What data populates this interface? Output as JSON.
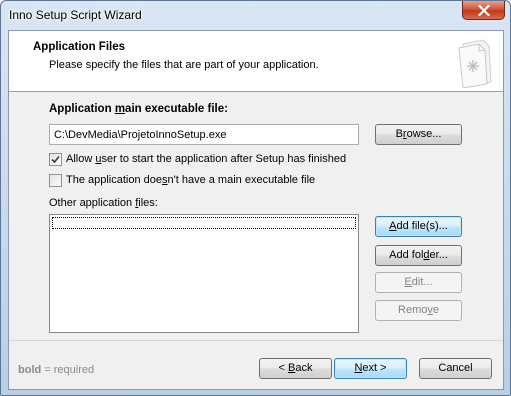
{
  "window": {
    "title": "Inno Setup Script Wizard"
  },
  "header": {
    "title": "Application Files",
    "subtitle": "Please specify the files that are part of your application.",
    "icon": "document-icon"
  },
  "main_executable": {
    "label_pre": "Application ",
    "label_access": "m",
    "label_post": "ain executable file:",
    "value": "C:\\DevMedia\\ProjetoInnoSetup.exe",
    "browse_pre": "B",
    "browse_access": "r",
    "browse_post": "owse..."
  },
  "options": {
    "allow_start_pre": "Allow ",
    "allow_start_access": "u",
    "allow_start_post": "ser to start the application after Setup has finished",
    "allow_start_checked": true,
    "no_main_exe_pre": "The application doe",
    "no_main_exe_access": "s",
    "no_main_exe_post": "n't have a main executable file",
    "no_main_exe_checked": false
  },
  "other_files": {
    "label_pre": "Other application ",
    "label_access": "f",
    "label_post": "iles:",
    "items": [],
    "add_files_pre": "",
    "add_files_access": "A",
    "add_files_post": "dd file(s)...",
    "add_folder_pre": "Add fol",
    "add_folder_access": "d",
    "add_folder_post": "er...",
    "edit_pre": "",
    "edit_access": "E",
    "edit_post": "dit...",
    "remove_pre": "Remo",
    "remove_access": "v",
    "remove_post": "e"
  },
  "footer": {
    "required_bold": "bold",
    "required_text": " = required",
    "back_pre": "< ",
    "back_access": "B",
    "back_post": "ack",
    "next_access": "N",
    "next_post": "ext >",
    "cancel": "Cancel"
  },
  "colors": {
    "title_bar": "#c6d8ec",
    "close_button": "#c33a1d",
    "dialog_bg": "#f0f0f0",
    "focus_border": "#3c7fb1"
  }
}
